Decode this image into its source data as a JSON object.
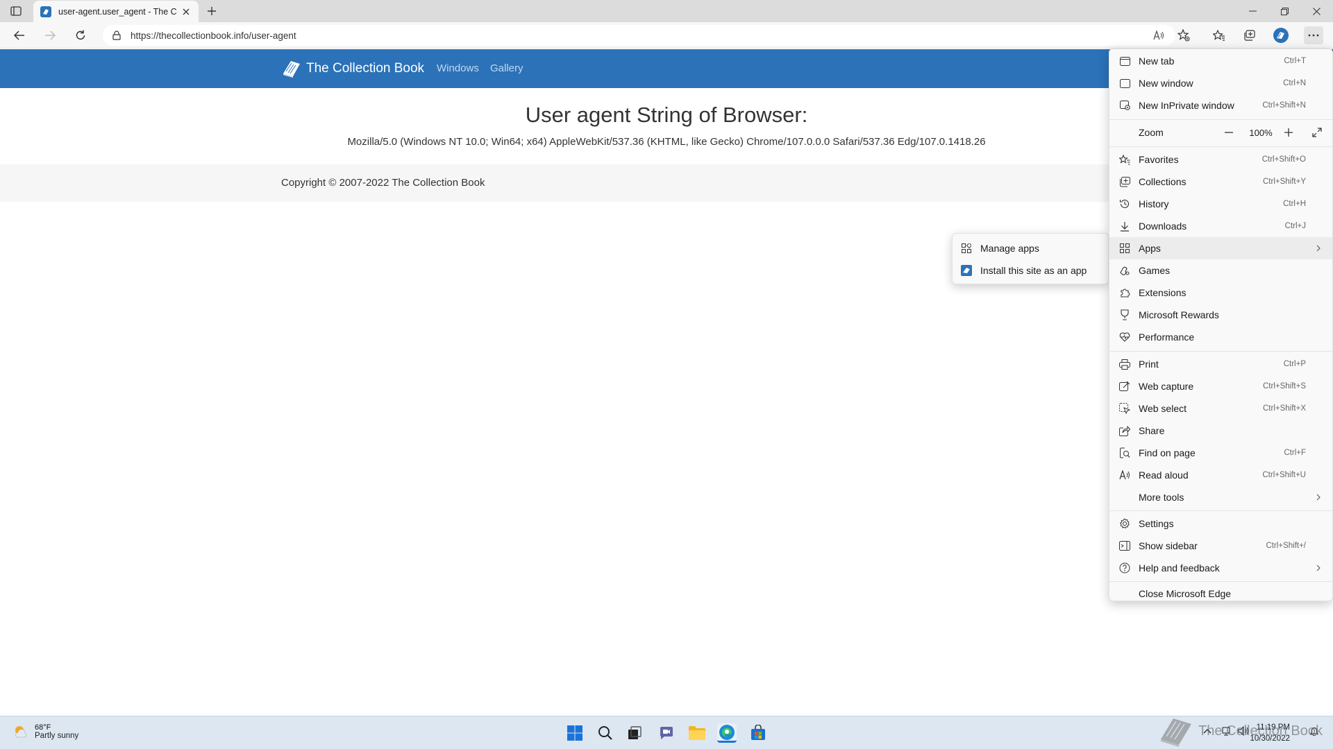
{
  "browser": {
    "tab": {
      "title": "user-agent.user_agent - The Coll"
    },
    "address_bar": {
      "url_host": "https://thecollectionbook.info",
      "url_path": "/user-agent"
    }
  },
  "page": {
    "brand": "The Collection Book",
    "nav": [
      "Windows",
      "Gallery"
    ],
    "heading": "User agent String of Browser:",
    "user_agent": "Mozilla/5.0 (Windows NT 10.0; Win64; x64) AppleWebKit/537.36 (KHTML, like Gecko) Chrome/107.0.0.0 Safari/537.36 Edg/107.0.1418.26",
    "footer": "Copyright © 2007-2022 The Collection Book",
    "header_color": "#2b72b9"
  },
  "menu": {
    "items": [
      {
        "label": "New tab",
        "shortcut": "Ctrl+T",
        "icon": "new-tab-icon"
      },
      {
        "label": "New window",
        "shortcut": "Ctrl+N",
        "icon": "new-window-icon"
      },
      {
        "label": "New InPrivate window",
        "shortcut": "Ctrl+Shift+N",
        "icon": "inprivate-icon"
      },
      {
        "label": "Zoom",
        "shortcut": "",
        "icon": ""
      },
      {
        "label": "Favorites",
        "shortcut": "Ctrl+Shift+O",
        "icon": "favorites-icon"
      },
      {
        "label": "Collections",
        "shortcut": "Ctrl+Shift+Y",
        "icon": "collections-icon"
      },
      {
        "label": "History",
        "shortcut": "Ctrl+H",
        "icon": "history-icon"
      },
      {
        "label": "Downloads",
        "shortcut": "Ctrl+J",
        "icon": "downloads-icon"
      },
      {
        "label": "Apps",
        "shortcut": "",
        "icon": "apps-icon"
      },
      {
        "label": "Games",
        "shortcut": "",
        "icon": "games-icon"
      },
      {
        "label": "Extensions",
        "shortcut": "",
        "icon": "extensions-icon"
      },
      {
        "label": "Microsoft Rewards",
        "shortcut": "",
        "icon": "rewards-icon"
      },
      {
        "label": "Performance",
        "shortcut": "",
        "icon": "performance-icon"
      },
      {
        "label": "Print",
        "shortcut": "Ctrl+P",
        "icon": "print-icon"
      },
      {
        "label": "Web capture",
        "shortcut": "Ctrl+Shift+S",
        "icon": "web-capture-icon"
      },
      {
        "label": "Web select",
        "shortcut": "Ctrl+Shift+X",
        "icon": "web-select-icon"
      },
      {
        "label": "Share",
        "shortcut": "",
        "icon": "share-icon"
      },
      {
        "label": "Find on page",
        "shortcut": "Ctrl+F",
        "icon": "find-icon"
      },
      {
        "label": "Read aloud",
        "shortcut": "Ctrl+Shift+U",
        "icon": "read-aloud-icon"
      },
      {
        "label": "More tools",
        "shortcut": "",
        "icon": ""
      },
      {
        "label": "Settings",
        "shortcut": "",
        "icon": "settings-icon"
      },
      {
        "label": "Show sidebar",
        "shortcut": "Ctrl+Shift+/",
        "icon": "sidebar-icon"
      },
      {
        "label": "Help and feedback",
        "shortcut": "",
        "icon": "help-icon"
      },
      {
        "label": "Close Microsoft Edge",
        "shortcut": "",
        "icon": ""
      }
    ],
    "zoom_value": "100%"
  },
  "apps_submenu": {
    "items": [
      "Manage apps",
      "Install this site as an app"
    ]
  },
  "taskbar": {
    "weather_temp": "68°F",
    "weather_cond": "Partly sunny",
    "time": "11:19 PM",
    "date": "10/30/2022"
  },
  "watermark": "The Collection Book"
}
